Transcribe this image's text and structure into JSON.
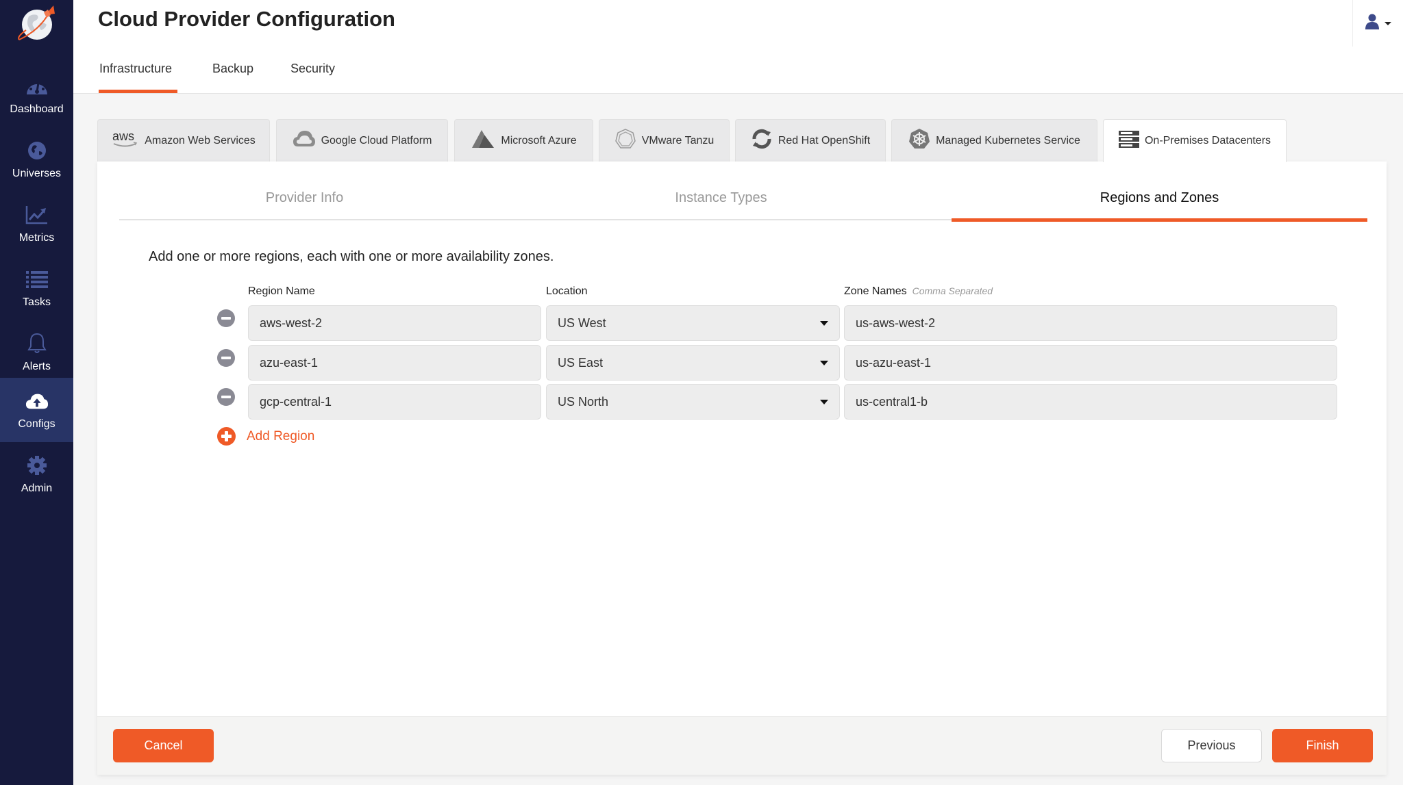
{
  "sidebar": {
    "logo": "yugabyte-rocket-globe-logo",
    "items": [
      {
        "label": "Dashboard",
        "icon": "dashboard-gauge-icon",
        "active": false
      },
      {
        "label": "Universes",
        "icon": "globe-icon",
        "active": false
      },
      {
        "label": "Metrics",
        "icon": "chart-line-icon",
        "active": false
      },
      {
        "label": "Tasks",
        "icon": "list-icon",
        "active": false
      },
      {
        "label": "Alerts",
        "icon": "bell-icon",
        "active": false
      },
      {
        "label": "Configs",
        "icon": "cloud-upload-icon",
        "active": true
      },
      {
        "label": "Admin",
        "icon": "gear-icon",
        "active": false
      }
    ]
  },
  "header": {
    "title": "Cloud Provider Configuration",
    "tabs": [
      {
        "label": "Infrastructure",
        "active": true
      },
      {
        "label": "Backup",
        "active": false
      },
      {
        "label": "Security",
        "active": false
      }
    ],
    "user_icon": "user-icon"
  },
  "provider_tabs": [
    {
      "label": "Amazon Web Services",
      "icon": "aws-logo-icon",
      "active": false
    },
    {
      "label": "Google Cloud Platform",
      "icon": "gcp-logo-icon",
      "active": false
    },
    {
      "label": "Microsoft Azure",
      "icon": "azure-logo-icon",
      "active": false
    },
    {
      "label": "VMware Tanzu",
      "icon": "tanzu-logo-icon",
      "active": false
    },
    {
      "label": "Red Hat OpenShift",
      "icon": "openshift-logo-icon",
      "active": false
    },
    {
      "label": "Managed Kubernetes Service",
      "icon": "kubernetes-logo-icon",
      "active": false
    },
    {
      "label": "On-Premises Datacenters",
      "icon": "server-rack-icon",
      "active": true
    }
  ],
  "steps": [
    {
      "label": "Provider Info",
      "active": false
    },
    {
      "label": "Instance Types",
      "active": false
    },
    {
      "label": "Regions and Zones",
      "active": true
    }
  ],
  "form": {
    "instructions": "Add one or more regions, each with one or more availability zones.",
    "columns": {
      "region": "Region Name",
      "location": "Location",
      "zones": "Zone Names",
      "zones_hint": "Comma Separated"
    },
    "rows": [
      {
        "region": "aws-west-2",
        "location": "US West",
        "zones": "us-aws-west-2"
      },
      {
        "region": "azu-east-1",
        "location": "US East",
        "zones": "us-azu-east-1"
      },
      {
        "region": "gcp-central-1",
        "location": "US North",
        "zones": "us-central1-b"
      }
    ],
    "add_region_label": "Add Region"
  },
  "footer": {
    "cancel": "Cancel",
    "previous": "Previous",
    "finish": "Finish"
  },
  "colors": {
    "accent": "#ef5a27",
    "sidebar_bg": "#161a3d",
    "sidebar_active": "#283466",
    "icon_muted": "#4a5a9a"
  }
}
